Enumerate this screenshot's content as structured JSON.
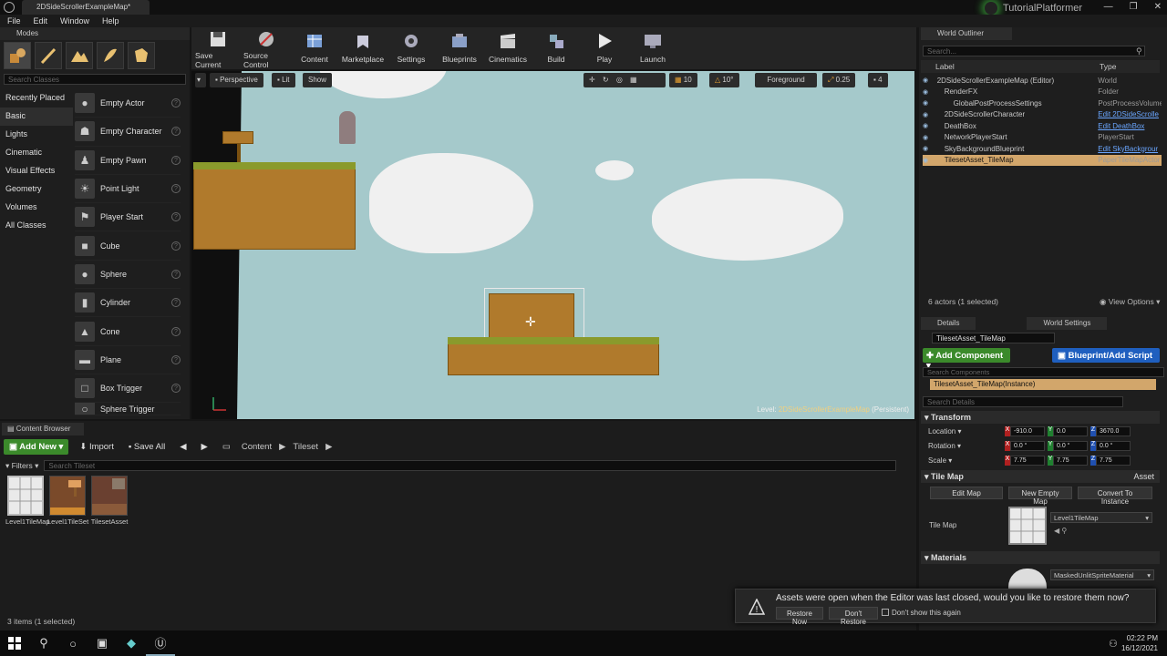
{
  "window": {
    "tab_title": "2DSideScrollerExampleMap*",
    "project_name": "TutorialPlatformer",
    "controls": [
      "—",
      "❐",
      "✕"
    ]
  },
  "menu": [
    "File",
    "Edit",
    "Window",
    "Help"
  ],
  "modes": {
    "header": "Modes",
    "search_placeholder": "Search Classes",
    "categories": [
      "Recently Placed",
      "Basic",
      "Lights",
      "Cinematic",
      "Visual Effects",
      "Geometry",
      "Volumes",
      "All Classes"
    ],
    "active_category": "Basic",
    "classes": [
      "Empty Actor",
      "Empty Character",
      "Empty Pawn",
      "Point Light",
      "Player Start",
      "Cube",
      "Sphere",
      "Cylinder",
      "Cone",
      "Plane",
      "Box Trigger",
      "Sphere Trigger"
    ],
    "help_glyph": "?"
  },
  "toolbar": {
    "buttons": [
      "Save Current",
      "Source Control",
      "Content",
      "Marketplace",
      "Settings",
      "Blueprints",
      "Cinematics",
      "Build",
      "Play",
      "Launch"
    ]
  },
  "viewport": {
    "perspective": "Perspective",
    "lit": "Lit",
    "show": "Show",
    "grid_snap": "10",
    "rot_snap": "10°",
    "layer": "Foreground",
    "scale_snap": "0.25",
    "camera_speed": "4",
    "level_label": "Level:",
    "level_name": "2DSideScrollerExampleMap",
    "level_suffix": "(Persistent)"
  },
  "content_browser": {
    "tab": "Content Browser",
    "add_new": "Add New",
    "import": "Import",
    "save_all": "Save All",
    "path": [
      "Content",
      "Tileset"
    ],
    "filters": "Filters",
    "search_placeholder": "Search Tileset",
    "assets": [
      {
        "name": "Level1TileMap"
      },
      {
        "name": "Level1TileSet"
      },
      {
        "name": "TilesetAsset"
      }
    ],
    "status": "3 items (1 selected)"
  },
  "outliner": {
    "tab": "World Outliner",
    "search_placeholder": "Search...",
    "col_label": "Label",
    "col_type": "Type",
    "rows": [
      {
        "label": "2DSideScrollerExampleMap (Editor)",
        "type": "World",
        "kind": "plain"
      },
      {
        "label": "RenderFX",
        "type": "Folder",
        "kind": "plain"
      },
      {
        "label": "GlobalPostProcessSettings",
        "type": "PostProcessVolume",
        "kind": "plain"
      },
      {
        "label": "2DSideScrollerCharacter",
        "type": "Edit 2DSideScrolle",
        "kind": "link"
      },
      {
        "label": "DeathBox",
        "type": "Edit DeathBox",
        "kind": "link"
      },
      {
        "label": "NetworkPlayerStart",
        "type": "PlayerStart",
        "kind": "plain"
      },
      {
        "label": "SkyBackgroundBlueprint",
        "type": "Edit SkyBackgrour",
        "kind": "link"
      },
      {
        "label": "TilesetAsset_TileMap",
        "type": "PaperTileMapActor",
        "kind": "plain",
        "selected": true
      }
    ],
    "count": "6 actors (1 selected)",
    "view_options": "View Options"
  },
  "details": {
    "tab_details": "Details",
    "tab_world": "World Settings",
    "name": "TilesetAsset_TileMap",
    "add_component": "Add Component",
    "blueprint": "Blueprint/Add Script",
    "search_components": "Search Components",
    "component_row": "TilesetAsset_TileMap(Instance)",
    "search_details": "Search Details",
    "transform": "Transform",
    "location": {
      "label": "Location",
      "x": "-910.0",
      "y": "0.0",
      "z": "3670.0"
    },
    "rotation": {
      "label": "Rotation",
      "x": "0.0 °",
      "y": "0.0 °",
      "z": "0.0 °"
    },
    "scale": {
      "label": "Scale",
      "x": "7.75",
      "y": "7.75",
      "z": "7.75"
    },
    "tile_map_section": "Tile Map",
    "asset_label": "Asset",
    "edit_map": "Edit Map",
    "new_empty_map": "New Empty Map",
    "convert_instance": "Convert To Instance",
    "tile_map_label": "Tile Map",
    "tile_map_value": "Level1TileMap",
    "materials": "Materials",
    "material_value": "MaskedUnlitSpriteMaterial"
  },
  "toast": {
    "message": "Assets were open when the Editor was last closed, would you like to restore them now?",
    "restore": "Restore Now",
    "dont_restore": "Don't Restore",
    "dont_show": "Don't show this again"
  },
  "taskbar": {
    "time": "02:22 PM",
    "date": "16/12/2021"
  },
  "colors": {
    "accent_green": "#3b8a2b",
    "accent_blue": "#1f5fbf",
    "selection": "#d2a66b",
    "sky": "#a5c9cb",
    "tile": "#b07a2c"
  }
}
